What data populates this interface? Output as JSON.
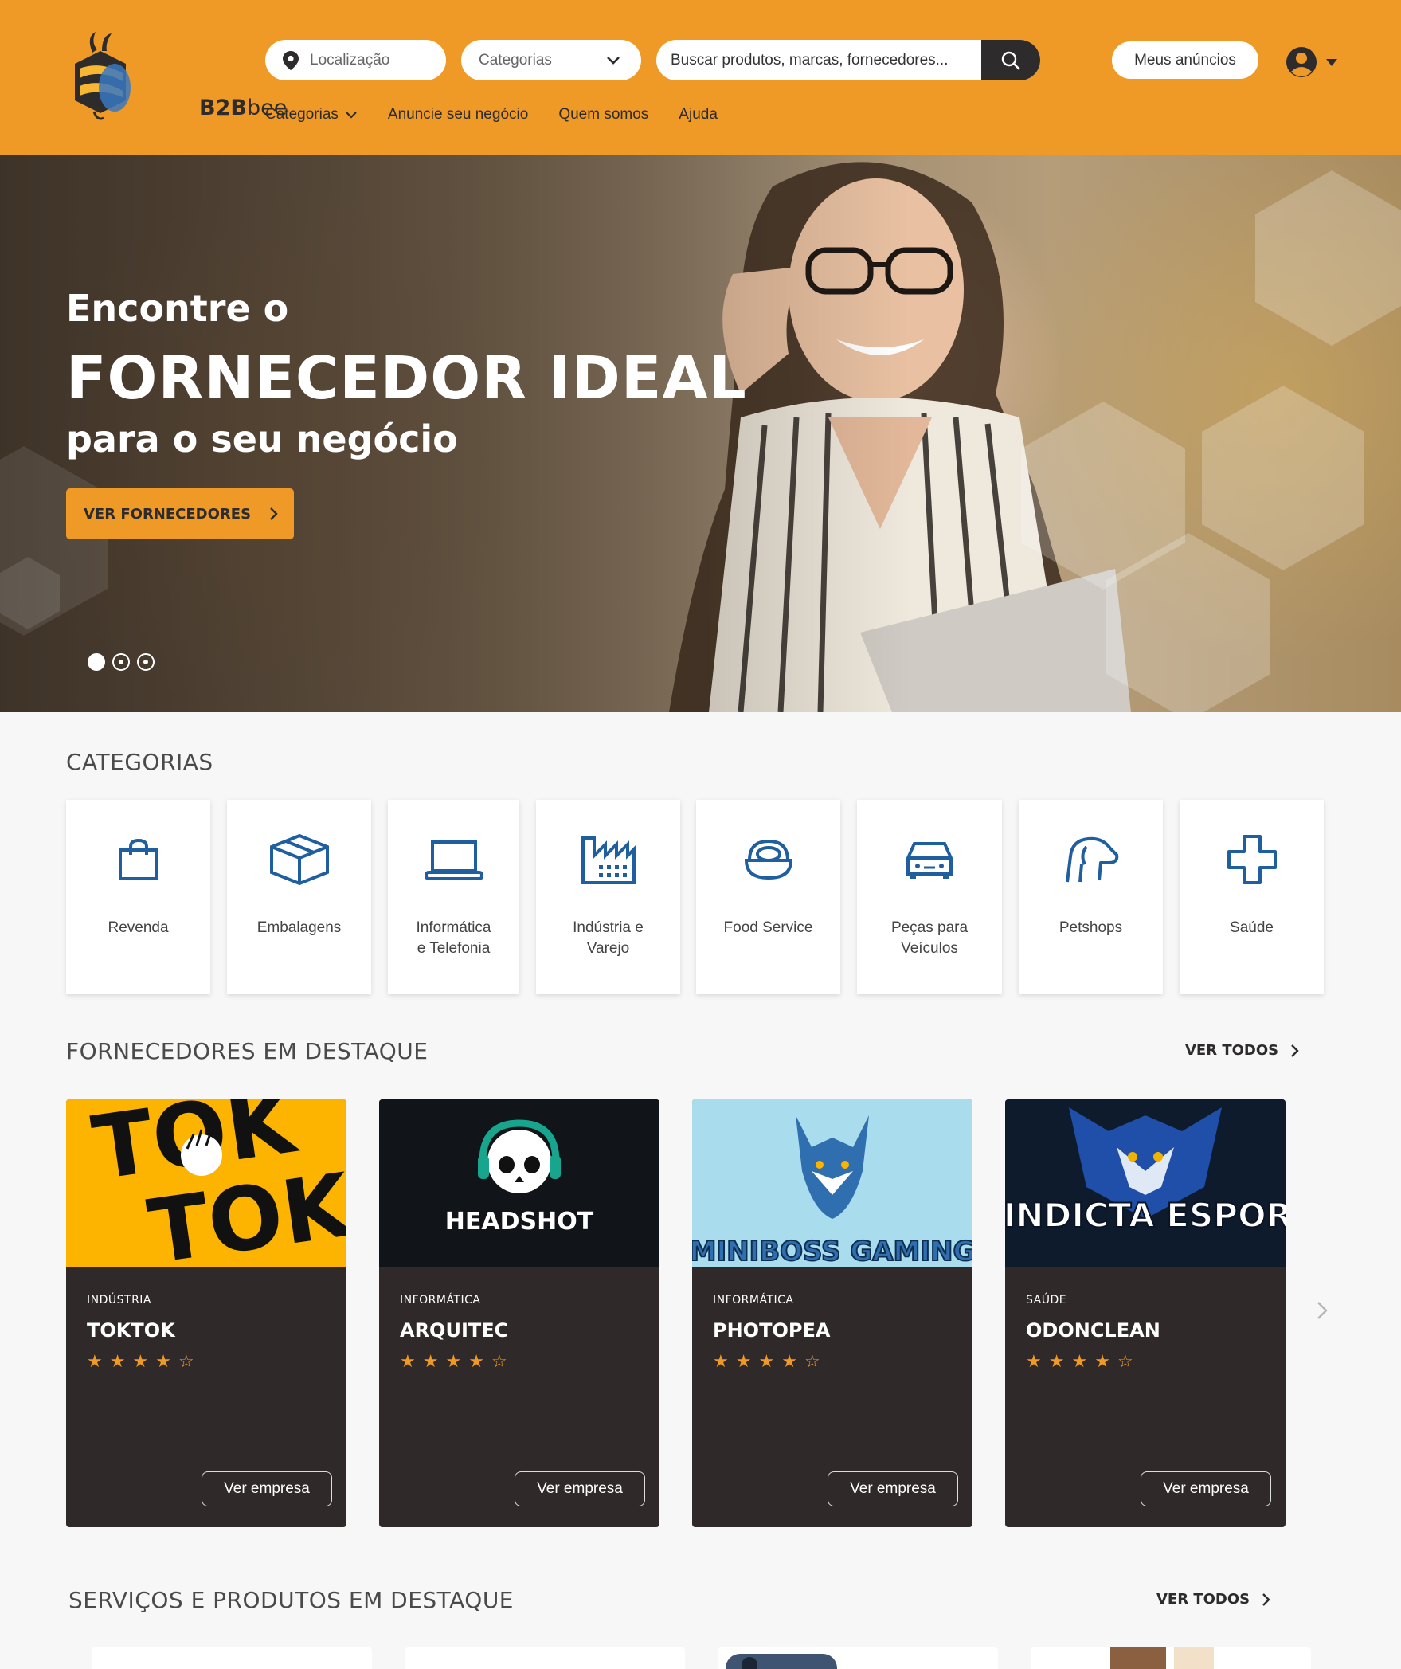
{
  "header": {
    "logo": {
      "brand_bold": "B2B",
      "brand_light": "bee"
    },
    "location_placeholder": "Localização",
    "categories_select": "Categorias",
    "search_placeholder": "Buscar produtos, marcas, fornecedores...",
    "my_ads": "Meus anúncios",
    "nav": {
      "categories": "Categorias",
      "advertise": "Anuncie seu negócio",
      "about": "Quem somos",
      "help": "Ajuda"
    }
  },
  "hero": {
    "line1": "Encontre o",
    "line2": "FORNECEDOR IDEAL",
    "line3": "para o seu negócio",
    "cta": "VER FORNECEDORES",
    "slides": 3,
    "active_slide": 1
  },
  "categories": {
    "title": "CATEGORIAS",
    "items": [
      {
        "label": "Revenda",
        "icon": "shopping-bag-icon"
      },
      {
        "label": "Embalagens",
        "icon": "box-icon"
      },
      {
        "label": "Informática\ne Telefonia",
        "icon": "laptop-icon"
      },
      {
        "label": "Indústria e\nVarejo",
        "icon": "factory-icon"
      },
      {
        "label": "Food Service",
        "icon": "food-bowl-icon"
      },
      {
        "label": "Peças para\nVeículos",
        "icon": "car-icon"
      },
      {
        "label": "Petshops",
        "icon": "dog-icon"
      },
      {
        "label": "Saúde",
        "icon": "health-cross-icon"
      }
    ]
  },
  "featured_suppliers": {
    "title": "FORNECEDORES EM DESTAQUE",
    "see_all": "VER TODOS",
    "items": [
      {
        "category": "INDÚSTRIA",
        "name": "TOKTOK",
        "rating": 4,
        "max_rating": 5,
        "button": "Ver empresa",
        "logo_text": "TOK TOK"
      },
      {
        "category": "INFORMÁTICA",
        "name": "ARQUITEC",
        "rating": 4,
        "max_rating": 5,
        "button": "Ver empresa",
        "logo_text": "HEADSHOT"
      },
      {
        "category": "INFORMÁTICA",
        "name": "PHOTOPEA",
        "rating": 4,
        "max_rating": 5,
        "button": "Ver empresa",
        "logo_text": "MINIBOSS GAMING"
      },
      {
        "category": "SAÚDE",
        "name": "ODONCLEAN",
        "rating": 4,
        "max_rating": 5,
        "button": "Ver empresa",
        "logo_text": "VINDICTA ESPORT"
      }
    ]
  },
  "featured_products": {
    "title": "SERVIÇOS E PRODUTOS EM DESTAQUE",
    "see_all": "VER TODOS"
  },
  "colors": {
    "brand_orange": "#ef9a26",
    "dark": "#2d2b2c",
    "card_dark": "#2f2929",
    "icon_blue": "#1f5fa0"
  }
}
